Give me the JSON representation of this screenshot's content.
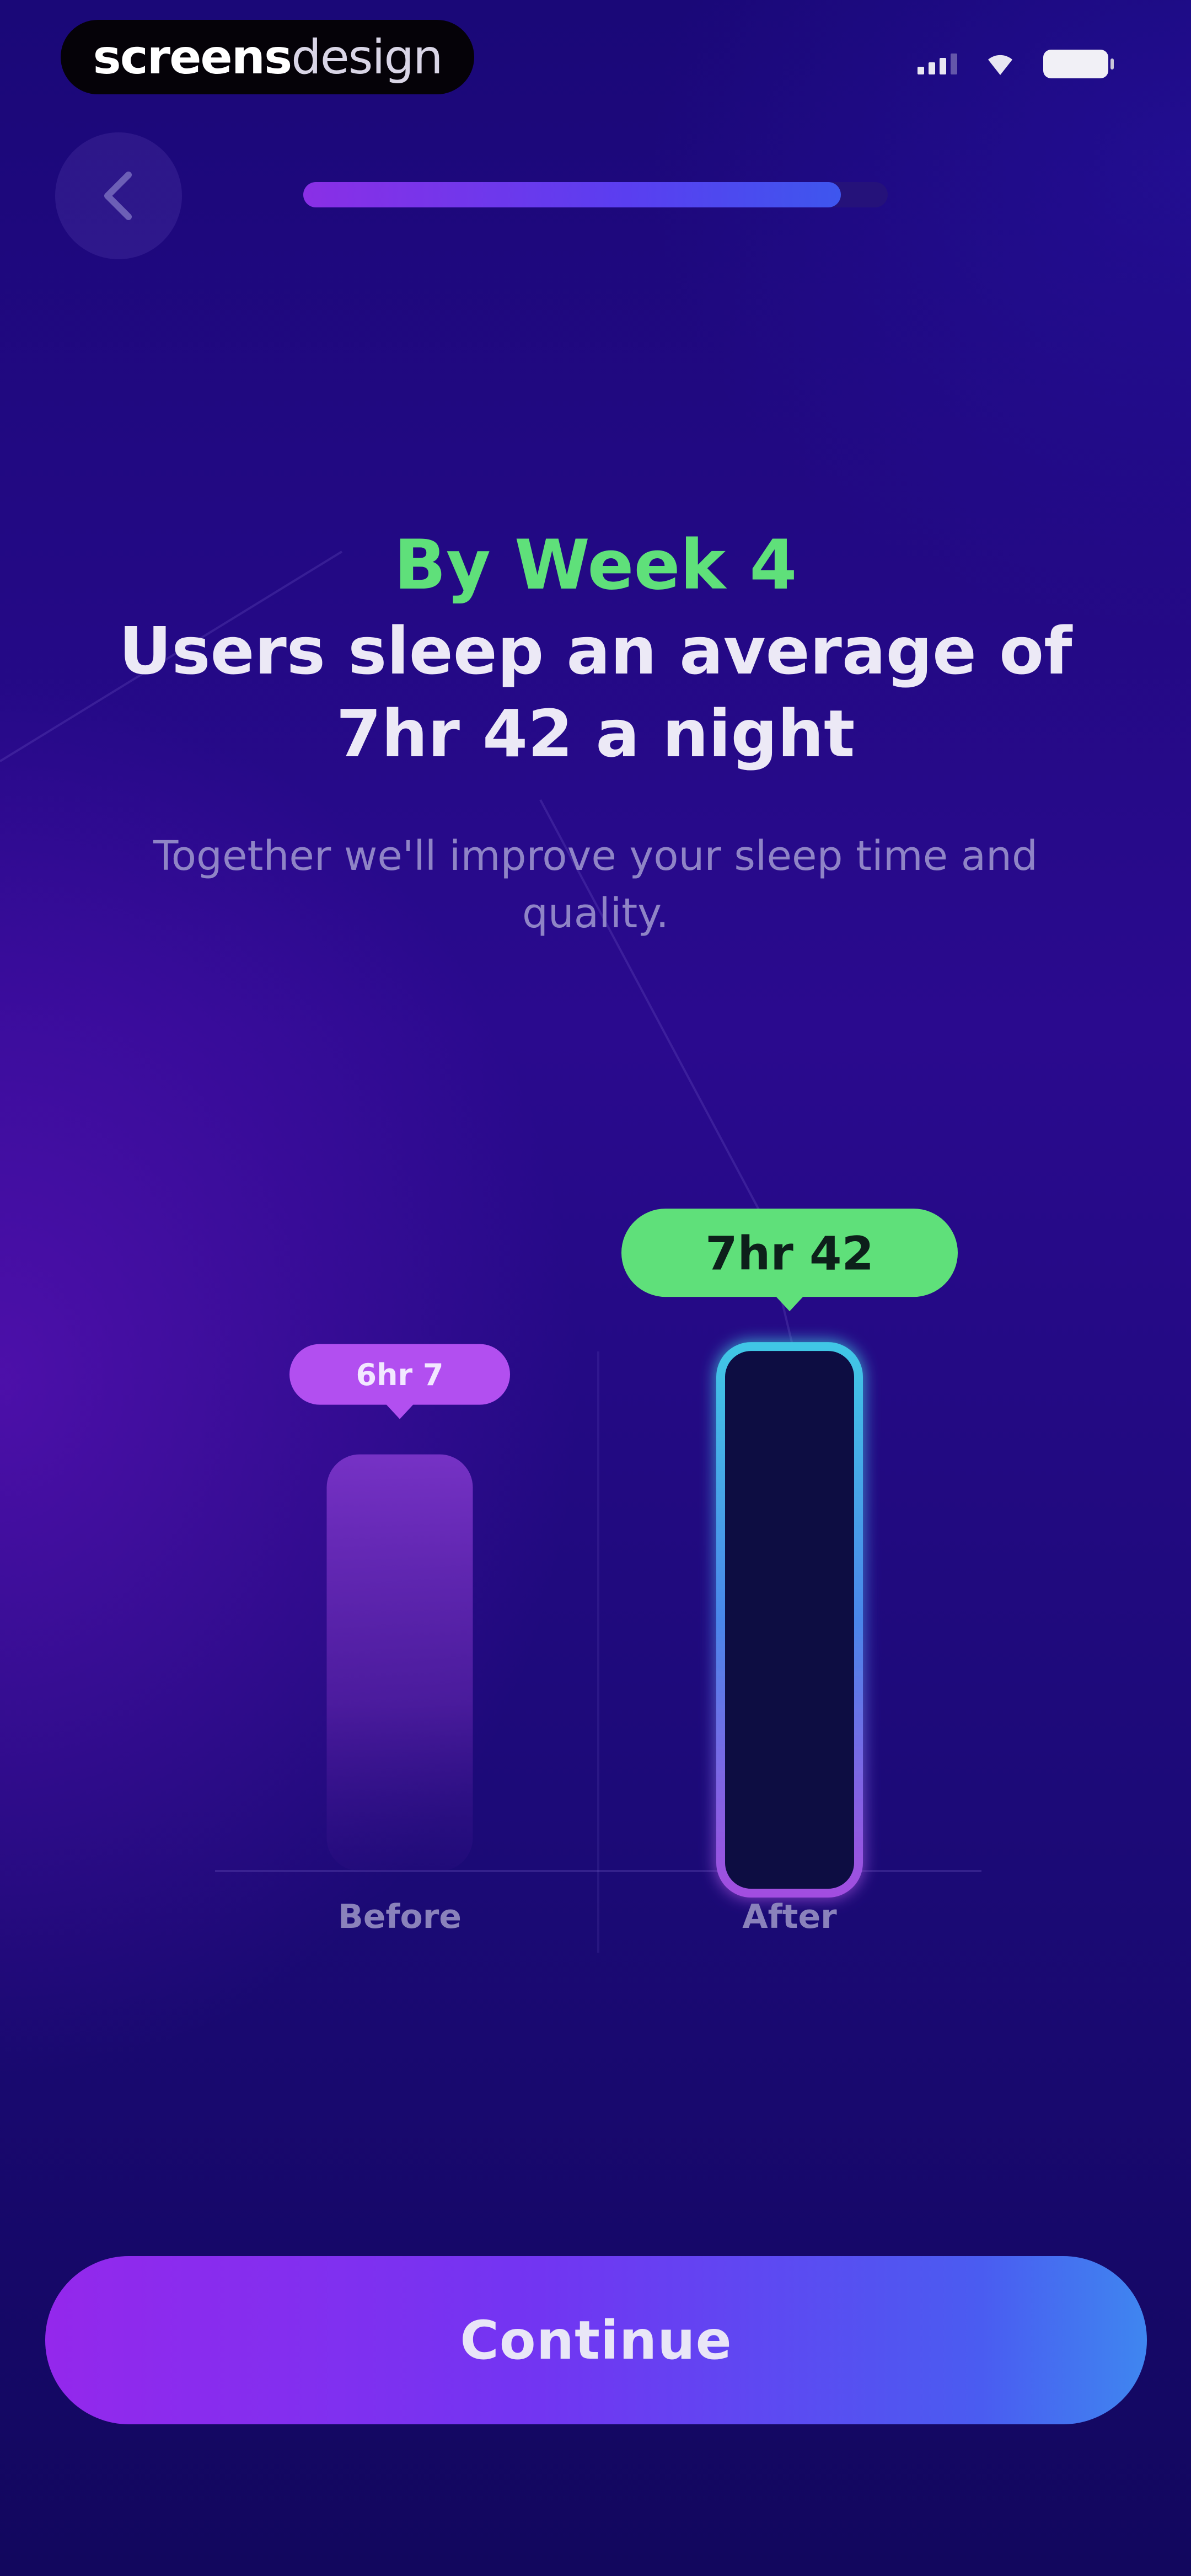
{
  "status_bar": {
    "brand_bold": "screens",
    "brand_light": "design",
    "icons": [
      "signal-icon",
      "wifi-icon",
      "battery-icon"
    ]
  },
  "header": {
    "back_icon": "chevron-left-icon",
    "progress": 0.92
  },
  "content": {
    "eyebrow": "By Week 4",
    "headline": "Users sleep an average of 7hr 42 a night",
    "subtitle": "Together we'll improve your sleep time and quality."
  },
  "chart_data": {
    "type": "bar",
    "categories": [
      "Before",
      "After"
    ],
    "values": [
      6.117,
      7.7
    ],
    "value_labels": [
      "6hr 7",
      "7hr 42"
    ],
    "ylim": [
      0,
      8.6
    ]
  },
  "footer": {
    "continue_label": "Continue"
  },
  "colors": {
    "accent_green": "#5fe07a",
    "before_bar": "#7a34c8",
    "after_bar_fill": "#0c0743",
    "after_bar_border_top": "#41c7e6",
    "after_bar_border_bottom": "#a24ee0",
    "button_start": "#9428ec",
    "button_end": "#3f86f0"
  }
}
